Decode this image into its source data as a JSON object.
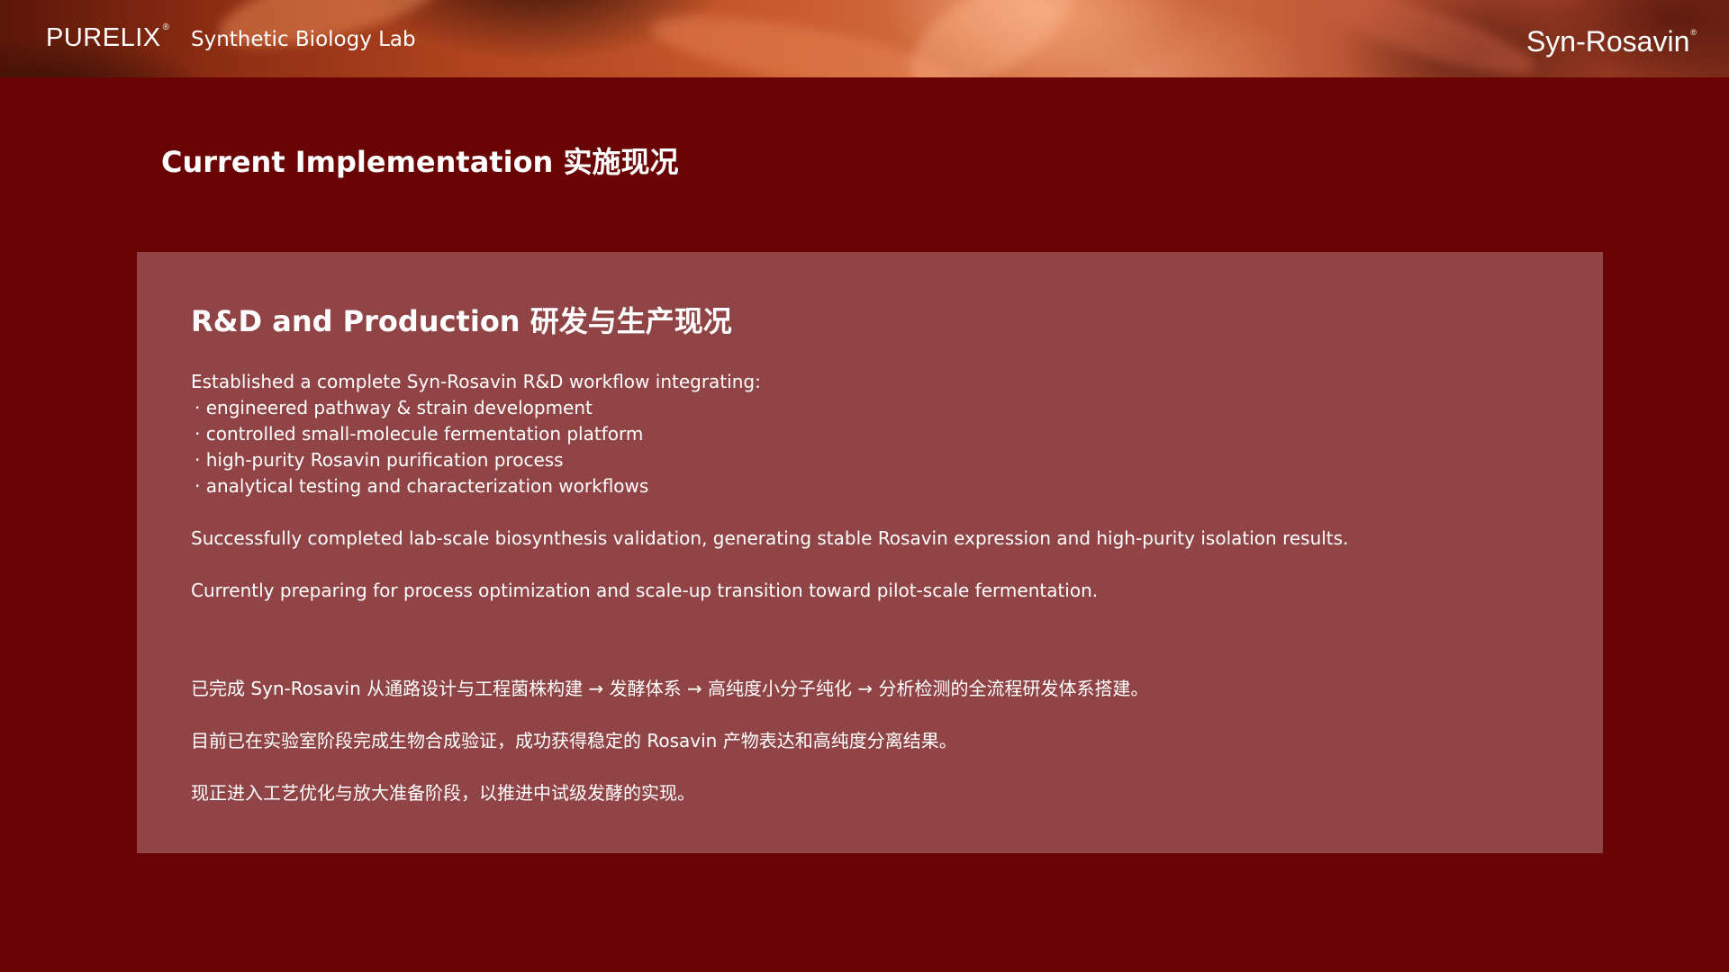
{
  "header": {
    "brand": "PURELIX",
    "brand_mark": "®",
    "tagline": "Synthetic Biology Lab",
    "product": "Syn-Rosavin",
    "product_mark": "®",
    "background": "red-canyon-photo"
  },
  "page": {
    "title": "Current Implementation 实施现况"
  },
  "card": {
    "title": "R&D and Production 研发与生产现况",
    "intro": "Established a complete Syn-Rosavin R&D workflow integrating:",
    "bullets": [
      "engineered pathway & strain development",
      "controlled small-molecule fermentation platform",
      "high-purity Rosavin purification process",
      "analytical testing and characterization workflows"
    ],
    "paragraph_1": "Successfully completed lab-scale biosynthesis validation, generating stable Rosavin expression and high-purity isolation results.",
    "paragraph_2": "Currently preparing for process optimization and scale-up transition toward pilot-scale fermentation.",
    "zh_1": "已完成 Syn-Rosavin 从通路设计与工程菌株构建 → 发酵体系 → 高纯度小分子纯化 → 分析检测的全流程研发体系搭建。",
    "zh_2": "目前已在实验室阶段完成生物合成验证，成功获得稳定的 Rosavin 产物表达和高纯度分离结果。",
    "zh_3": "现正进入工艺优化与放大准备阶段，以推进中试级发酵的实现。"
  },
  "colors": {
    "page_background": "#6a0303",
    "card_background": "#904446",
    "text": "#ffffff"
  }
}
